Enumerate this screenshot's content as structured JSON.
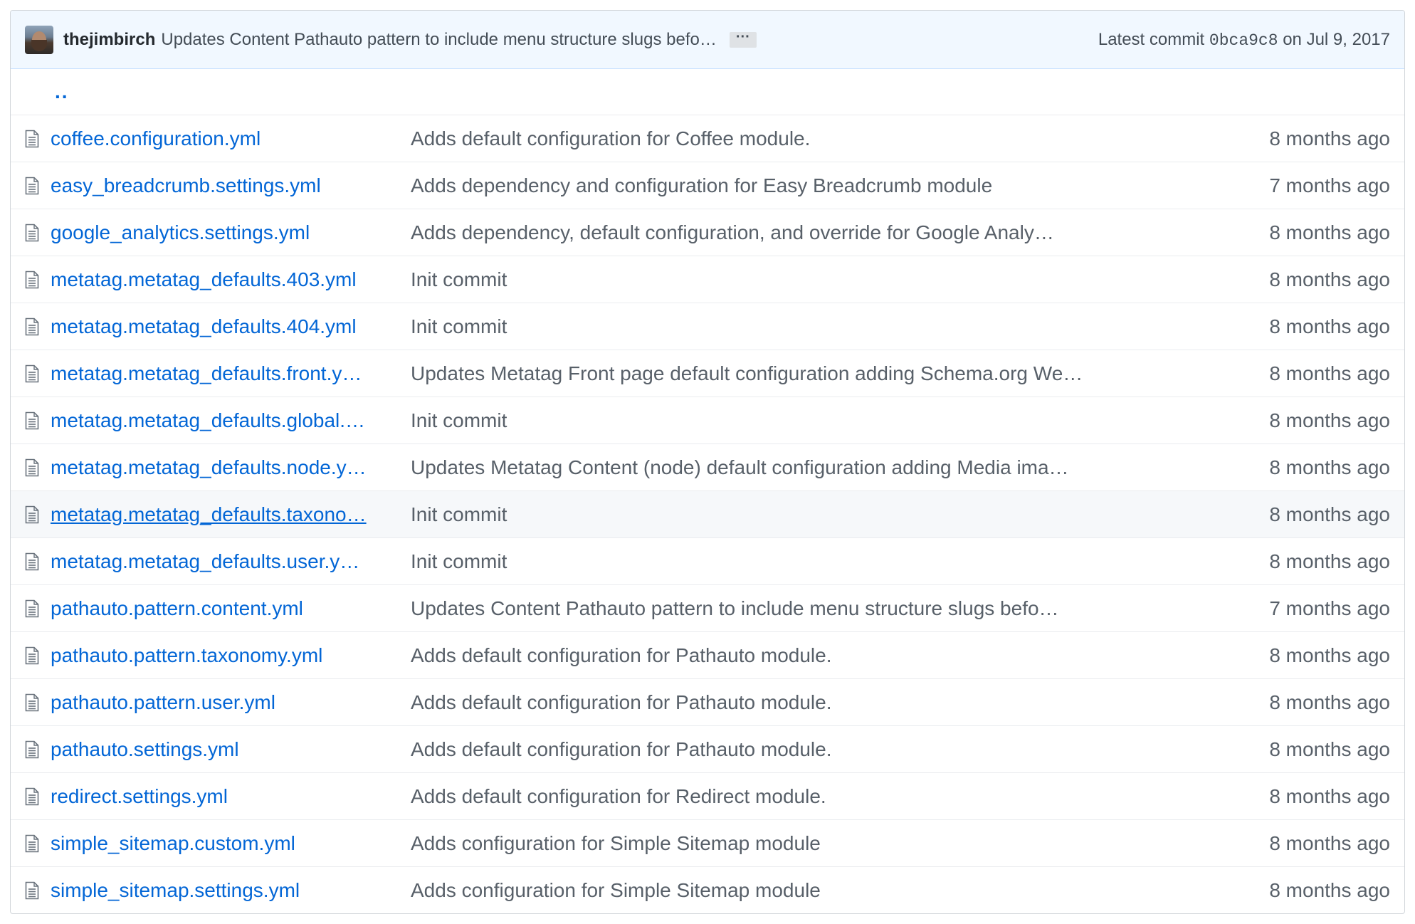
{
  "commit": {
    "author": "thejimbirch",
    "message": "Updates Content Pathauto pattern to include menu structure slugs befo…",
    "ellipsis": "···",
    "latest_label": "Latest commit",
    "sha": "0bca9c8",
    "date": "on Jul 9, 2017"
  },
  "parent_link": "..",
  "files": [
    {
      "name": "coffee.configuration.yml",
      "message": "Adds default configuration for Coffee module.",
      "age": "8 months ago"
    },
    {
      "name": "easy_breadcrumb.settings.yml",
      "message": "Adds dependency and configuration for Easy Breadcrumb module",
      "age": "7 months ago"
    },
    {
      "name": "google_analytics.settings.yml",
      "message": "Adds dependency, default configuration, and override for Google Analy…",
      "age": "8 months ago"
    },
    {
      "name": "metatag.metatag_defaults.403.yml",
      "message": "Init commit",
      "age": "8 months ago"
    },
    {
      "name": "metatag.metatag_defaults.404.yml",
      "message": "Init commit",
      "age": "8 months ago"
    },
    {
      "name": "metatag.metatag_defaults.front.y…",
      "message": "Updates Metatag Front page default configuration adding Schema.org We…",
      "age": "8 months ago"
    },
    {
      "name": "metatag.metatag_defaults.global.…",
      "message": "Init commit",
      "age": "8 months ago"
    },
    {
      "name": "metatag.metatag_defaults.node.y…",
      "message": "Updates Metatag Content (node) default configuration adding Media ima…",
      "age": "8 months ago"
    },
    {
      "name": "metatag.metatag_defaults.taxono…",
      "message": "Init commit",
      "age": "8 months ago"
    },
    {
      "name": "metatag.metatag_defaults.user.y…",
      "message": "Init commit",
      "age": "8 months ago"
    },
    {
      "name": "pathauto.pattern.content.yml",
      "message": "Updates Content Pathauto pattern to include menu structure slugs befo…",
      "age": "7 months ago"
    },
    {
      "name": "pathauto.pattern.taxonomy.yml",
      "message": "Adds default configuration for Pathauto module.",
      "age": "8 months ago"
    },
    {
      "name": "pathauto.pattern.user.yml",
      "message": "Adds default configuration for Pathauto module.",
      "age": "8 months ago"
    },
    {
      "name": "pathauto.settings.yml",
      "message": "Adds default configuration for Pathauto module.",
      "age": "8 months ago"
    },
    {
      "name": "redirect.settings.yml",
      "message": "Adds default configuration for Redirect module.",
      "age": "8 months ago"
    },
    {
      "name": "simple_sitemap.custom.yml",
      "message": "Adds configuration for Simple Sitemap module",
      "age": "8 months ago"
    },
    {
      "name": "simple_sitemap.settings.yml",
      "message": "Adds configuration for Simple Sitemap module",
      "age": "8 months ago"
    }
  ],
  "hovered_row_index": 8,
  "colors": {
    "link": "#0366d6",
    "commit_bar_bg": "#f1f8ff",
    "hover_bg": "#f6f8fa"
  },
  "icons": {
    "file_icon": "file-text-icon"
  }
}
